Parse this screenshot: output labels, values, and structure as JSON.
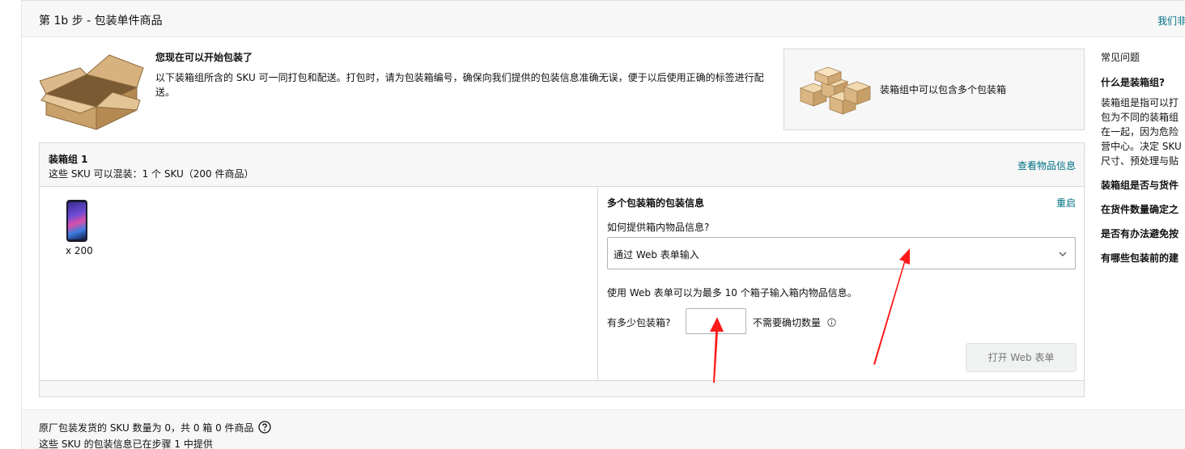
{
  "header": {
    "step_title": "第 1b 步 - 包装单件商品",
    "top_link": "我们非"
  },
  "intro": {
    "title": "您现在可以开始包装了",
    "text": "以下装箱组所含的 SKU 可一同打包和配送。打包时，请为包装箱编号，确保向我们提供的包装信息准确无误，便于以后使用正确的标签进行配送。"
  },
  "info_card": {
    "text": "装箱组中可以包含多个包装箱"
  },
  "faq": {
    "heading": "常见问题",
    "questions": [
      "什么是装箱组?",
      "装箱组是否与货件",
      "在货件数量确定之",
      "是否有办法避免按",
      "有哪些包装前的建"
    ],
    "answer_lines": [
      "装箱组是指可以打",
      "包为不同的装箱组",
      "在一起，因为危险",
      "营中心。决定 SKU",
      "尺寸、预处理与贴"
    ]
  },
  "group": {
    "title": "装箱组 1",
    "subtitle": "这些 SKU 可以混装：1 个 SKU（200 件商品）",
    "view_link": "查看物品信息",
    "item_qty": "x 200",
    "form": {
      "title": "多个包装箱的包装信息",
      "reset": "重启",
      "method_label": "如何提供箱内物品信息?",
      "method_value": "通过 Web 表单输入",
      "note": "使用 Web 表单可以为最多 10 个箱子输入箱内物品信息。",
      "count_label": "有多少包装箱?",
      "count_value": "",
      "exact_note": "不需要确切数量",
      "open_button": "打开 Web 表单"
    }
  },
  "bottom": {
    "line1": "原厂包装发货的 SKU 数量为 0，共 0 箱 0 件商品",
    "line2": "这些 SKU 的包装信息已在步骤 1 中提供"
  },
  "colors": {
    "link": "#007185",
    "panel_bg": "#f7f7f7",
    "border": "#d5d9d9",
    "annotation_arrow": "#ff1a1a"
  }
}
